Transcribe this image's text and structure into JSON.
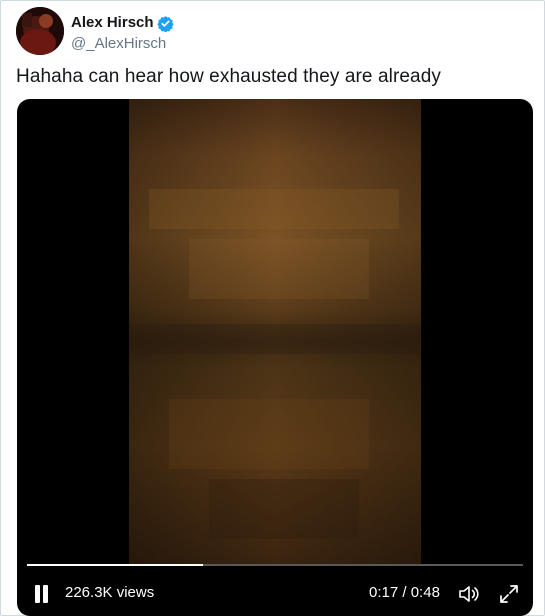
{
  "tweet": {
    "author_name": "Alex Hirsch",
    "author_handle": "@_AlexHirsch",
    "verified": true,
    "text": "Hahaha can hear how exhausted they are already"
  },
  "video": {
    "views": "226.3K views",
    "current_time": "0:17",
    "duration": "0:48",
    "time_separator": " / ",
    "progress_fraction": 0.354,
    "state": "playing",
    "controls": {
      "pause_icon": "pause-icon",
      "volume_icon": "volume-icon",
      "fullscreen_icon": "fullscreen-icon"
    }
  },
  "colors": {
    "verified_blue": "#1da1f2",
    "name_text": "#14171a",
    "handle_text": "#657786",
    "video_bg": "#000000",
    "video_tone": "#5a3a18"
  }
}
